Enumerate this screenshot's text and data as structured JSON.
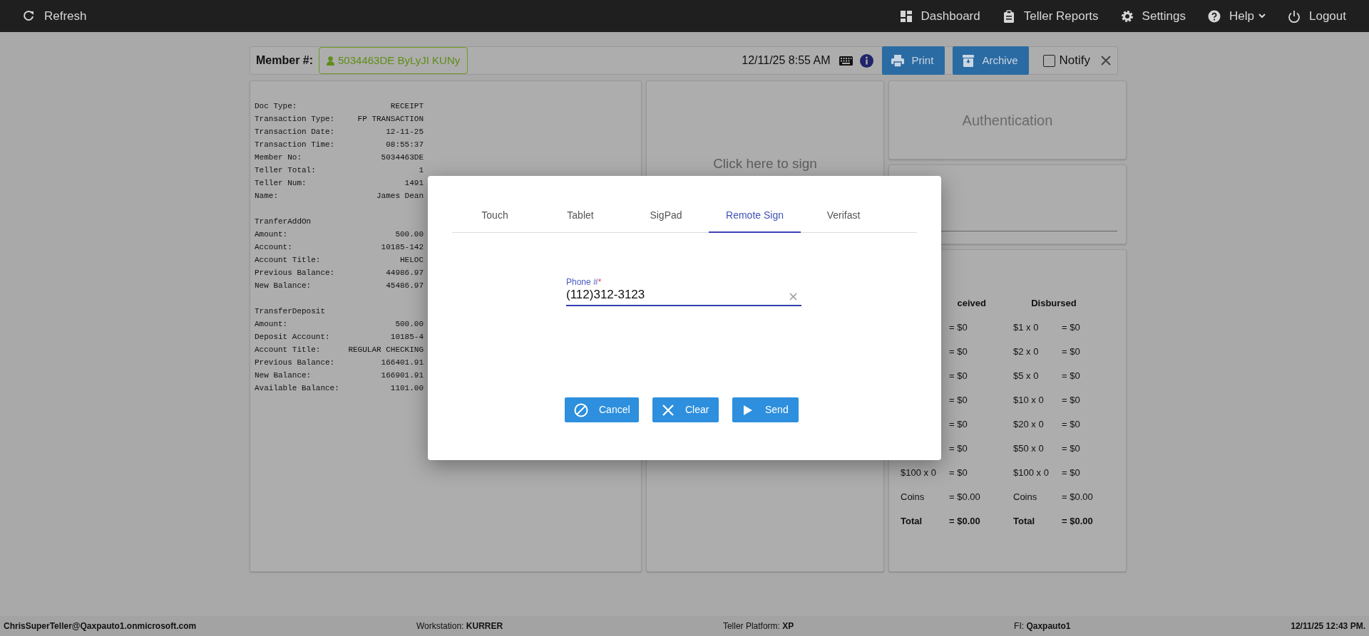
{
  "top_nav": {
    "left": [
      {
        "label": "Refresh",
        "menu": false
      }
    ],
    "right": [
      {
        "label": "Dashboard",
        "menu": false
      },
      {
        "label": "Teller Reports",
        "menu": false
      },
      {
        "label": "Settings",
        "menu": false
      },
      {
        "label": "Help",
        "menu": true
      },
      {
        "label": "Logout",
        "menu": false
      }
    ]
  },
  "header": {
    "member_label": "Member #:",
    "member": "5034463DE ByLyJI KUNy",
    "datetime": "12/11/25 8:55 AM",
    "buttons": [
      "Print",
      "Archive"
    ],
    "notify": {
      "label": "Notify",
      "checked": false
    }
  },
  "receipt": {
    "sections": [
      {
        "rows": [
          {
            "label": "Doc Type:",
            "value": "RECEIPT"
          },
          {
            "label": "Transaction Type:",
            "value": "FP TRANSACTION"
          },
          {
            "label": "Transaction Date:",
            "value": "12-11-25"
          },
          {
            "label": "Transaction Time:",
            "value": "08:55:37"
          },
          {
            "label": "Member No:",
            "value": "5034463DE"
          },
          {
            "label": "Teller Total:",
            "value": "1"
          },
          {
            "label": "Teller Num:",
            "value": "1491"
          },
          {
            "label": "Name:",
            "value": "James Dean"
          }
        ]
      },
      {
        "title": "TranferAddOn",
        "rows": [
          {
            "label": "Amount:",
            "value": "500.00"
          },
          {
            "label": "Account:",
            "value": "10185-142"
          },
          {
            "label": "Account Title:",
            "value": "HELOC"
          },
          {
            "label": "Previous Balance:",
            "value": "44986.97"
          },
          {
            "label": "New Balance:",
            "value": "45486.97"
          }
        ]
      },
      {
        "title": "TransferDeposit",
        "rows": [
          {
            "label": "Amount:",
            "value": "500.00"
          },
          {
            "label": "Deposit Account:",
            "value": "10185-4"
          },
          {
            "label": "Account Title:",
            "value": "REGULAR CHECKING"
          },
          {
            "label": "Previous Balance:",
            "value": "166401.91"
          },
          {
            "label": "New Balance:",
            "value": "166901.91"
          },
          {
            "label": "Available Balance:",
            "value": "1101.00"
          }
        ]
      }
    ]
  },
  "signature_panel": {
    "prompt": "Click here to sign"
  },
  "authentication_panel": {
    "title": "Authentication"
  },
  "cash_panel": {
    "headers": [
      "ceived",
      "Disbursed"
    ],
    "rows": [
      {
        "kind": "line",
        "received_amount": "= $0",
        "disbursed_denomination": "$1 x 0",
        "disbursed_amount": "= $0"
      },
      {
        "kind": "line",
        "received_amount": "= $0",
        "disbursed_denomination": "$2 x 0",
        "disbursed_amount": "= $0"
      },
      {
        "kind": "line",
        "received_amount": "= $0",
        "disbursed_denomination": "$5 x 0",
        "disbursed_amount": "= $0"
      },
      {
        "kind": "line",
        "received_amount": "= $0",
        "disbursed_denomination": "$10 x 0",
        "disbursed_amount": "= $0"
      },
      {
        "kind": "line",
        "received_amount": "= $0",
        "disbursed_denomination": "$20 x 0",
        "disbursed_amount": "= $0"
      },
      {
        "kind": "line",
        "received_amount": "= $0",
        "disbursed_denomination": "$50 x 0",
        "disbursed_amount": "= $0"
      },
      {
        "kind": "line",
        "received_denomination": "$100 x 0",
        "received_amount": "= $0",
        "disbursed_denomination": "$100 x 0",
        "disbursed_amount": "= $0"
      },
      {
        "kind": "line",
        "received_denomination": "Coins",
        "received_amount": "= $0.00",
        "disbursed_denomination": "Coins",
        "disbursed_amount": "= $0.00"
      },
      {
        "kind": "total",
        "received_denomination": "Total",
        "received_amount": "= $0.00",
        "disbursed_denomination": "Total",
        "disbursed_amount": "= $0.00"
      }
    ]
  },
  "modal": {
    "tabs": [
      {
        "label": "Touch",
        "selected": false
      },
      {
        "label": "Tablet",
        "selected": false
      },
      {
        "label": "SigPad",
        "selected": false
      },
      {
        "label": "Remote Sign",
        "selected": true
      },
      {
        "label": "Verifast",
        "selected": false
      }
    ],
    "phone_field": {
      "label": "Phone #",
      "required_mark": "*",
      "value": "(112)312-3123"
    },
    "buttons": [
      "Cancel",
      "Clear",
      "Send"
    ]
  },
  "status_bar": [
    {
      "value": "ChrisSuperTeller@Qaxpauto1.onmicrosoft.com"
    },
    {
      "label": "Workstation:",
      "value": "KURRER"
    },
    {
      "label": "Teller Platform:",
      "value": "XP"
    },
    {
      "label": "FI:",
      "value": "Qaxpauto1"
    },
    {
      "value": "12/11/25 12:43 PM."
    }
  ]
}
